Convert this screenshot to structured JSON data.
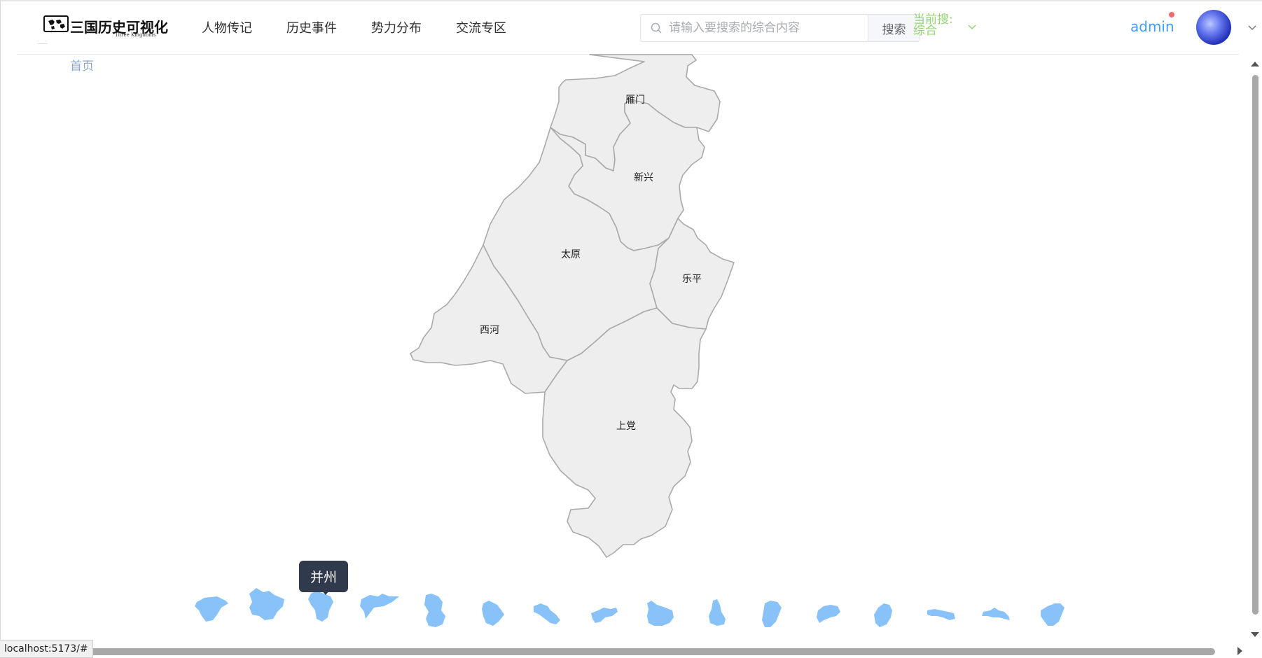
{
  "header": {
    "logo_text": "三国历史可视化",
    "logo_sub": "Three Kingdoms",
    "nav": [
      "人物传记",
      "历史事件",
      "势力分布",
      "交流专区"
    ],
    "search": {
      "placeholder": "请输入要搜索的综合内容",
      "button": "搜索"
    },
    "scope": {
      "label": "当前搜:",
      "value": "综合"
    },
    "user": {
      "name": "admin",
      "has_notification": true
    }
  },
  "breadcrumb": {
    "home": "首页"
  },
  "map": {
    "province": "并州",
    "regions": [
      "雁门",
      "新兴",
      "太原",
      "乐平",
      "西河",
      "上党"
    ],
    "fill_color": "#eeeeee",
    "border_color": "#aaaaaa"
  },
  "thumbnail_strip": {
    "count": 16,
    "active_index": 2,
    "color": "#89c2f8",
    "tooltip": "并州"
  },
  "browser": {
    "status_url": "localhost:5173/#"
  }
}
